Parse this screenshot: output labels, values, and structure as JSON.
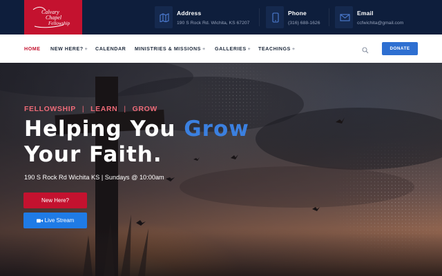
{
  "logo": {
    "line1": "Calvary",
    "line2": "Chapel",
    "line3": "Fellowship"
  },
  "contacts": [
    {
      "label": "Address",
      "value": "190 S Rock Rd. Wichita, KS 67207",
      "icon": "map-icon"
    },
    {
      "label": "Phone",
      "value": "(316) 688-1626",
      "icon": "phone-icon"
    },
    {
      "label": "Email",
      "value": "ccfwichita@gmail.com",
      "icon": "envelope-icon"
    }
  ],
  "nav": {
    "items": [
      {
        "label": "HOME",
        "has_submenu": false,
        "active": true
      },
      {
        "label": "NEW HERE?",
        "has_submenu": true
      },
      {
        "label": "CALENDAR",
        "has_submenu": false
      },
      {
        "label": "MINISTRIES & MISSIONS",
        "has_submenu": true
      },
      {
        "label": "GALLERIES",
        "has_submenu": true
      },
      {
        "label": "TEACHINGS",
        "has_submenu": true
      }
    ],
    "plus": "+",
    "donate_label": "DONATE"
  },
  "hero": {
    "tagline": [
      "FELLOWSHIP",
      "LEARN",
      "GROW"
    ],
    "separator": "|",
    "headline_part1": "Helping You ",
    "headline_accent": "Grow",
    "headline_line2": "Your Faith.",
    "address_line": "190 S Rock Rd Wichita KS | Sundays @ 10:00am",
    "btn_new_here": "New Here?",
    "btn_live_stream": "Live Stream"
  },
  "colors": {
    "brand_red": "#c4122f",
    "accent_blue": "#3b80e0",
    "topbar_navy": "#0e1e3c",
    "tagline_pink": "#ee6b78",
    "donate_blue": "#2e6fd1"
  }
}
